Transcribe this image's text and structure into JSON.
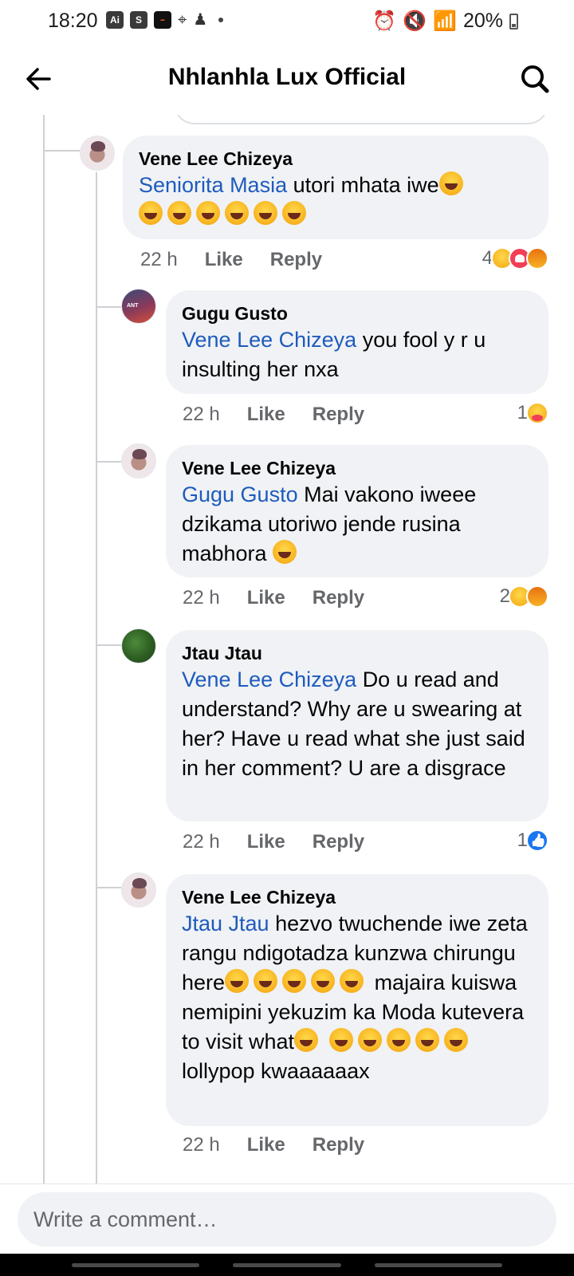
{
  "status_bar": {
    "time": "18:20",
    "left_icons": [
      "ai-badge-icon",
      "s-app-icon",
      "app-thumbnail-icon",
      "location-icon",
      "notification-icon",
      "more-dot-icon"
    ],
    "ai_label": "Ai",
    "s_label": "S",
    "battery": "20%"
  },
  "header": {
    "title": "Nhlanhla Lux Official",
    "back_icon": "arrow-left-icon",
    "search_icon": "search-icon"
  },
  "comments": [
    {
      "author": "Vene Lee Chizeya",
      "mention": "Seniorita Masia",
      "text": "utori mhata iwe",
      "time": "22 h",
      "like": "Like",
      "reply": "Reply",
      "reaction_count": "4",
      "reactions": [
        "haha",
        "love",
        "angry"
      ]
    },
    {
      "author": "Gugu Gusto",
      "mention": "Vene Lee Chizeya",
      "text": "you fool y r u insulting her nxa",
      "time": "22 h",
      "like": "Like",
      "reply": "Reply",
      "reaction_count": "1",
      "reactions": [
        "care"
      ]
    },
    {
      "author": "Vene Lee Chizeya",
      "mention": "Gugu Gusto",
      "text": "Mai vakono iweee dzikama utoriwo jende rusina mabhora",
      "time": "22 h",
      "like": "Like",
      "reply": "Reply",
      "reaction_count": "2",
      "reactions": [
        "haha",
        "angry"
      ]
    },
    {
      "author": "Jtau Jtau",
      "mention": "Vene Lee Chizeya",
      "text": "Do u read and understand? Why are u swearing at her? Have u read what she just said in her comment? U are a disgrace",
      "time": "22 h",
      "like": "Like",
      "reply": "Reply",
      "reaction_count": "1",
      "reactions": [
        "like"
      ]
    },
    {
      "author": "Vene Lee Chizeya",
      "mention": "Jtau Jtau",
      "text_part1": "hezvo twuchende iwe zeta rangu ndigotadza kunzwa chirungu here",
      "text_part2": "majaira kuiswa nemipini yekuzim ka Moda kutevera to visit what",
      "text_part3": "lollypop kwaaaaaax",
      "time": "22 h",
      "like": "Like",
      "reply": "Reply"
    }
  ],
  "composer": {
    "placeholder": "Write a comment…"
  }
}
